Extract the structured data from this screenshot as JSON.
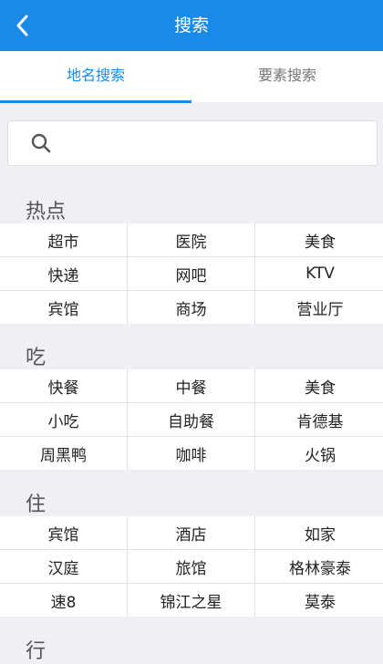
{
  "header": {
    "title": "搜索"
  },
  "tabs": [
    {
      "label": "地名搜索",
      "active": true
    },
    {
      "label": "要素搜索",
      "active": false
    }
  ],
  "search": {
    "placeholder": "",
    "value": ""
  },
  "sections": [
    {
      "title": "热点",
      "items": [
        "超市",
        "医院",
        "美食",
        "快递",
        "网吧",
        "KTV",
        "宾馆",
        "商场",
        "营业厅"
      ]
    },
    {
      "title": "吃",
      "items": [
        "快餐",
        "中餐",
        "美食",
        "小吃",
        "自助餐",
        "肯德基",
        "周黑鸭",
        "咖啡",
        "火锅"
      ]
    },
    {
      "title": "住",
      "items": [
        "宾馆",
        "酒店",
        "如家",
        "汉庭",
        "旅馆",
        "格林豪泰",
        "速8",
        "锦江之星",
        "莫泰"
      ]
    },
    {
      "title": "行",
      "items": []
    }
  ],
  "colors": {
    "accent": "#1a8ae8",
    "background": "#efeff4"
  }
}
